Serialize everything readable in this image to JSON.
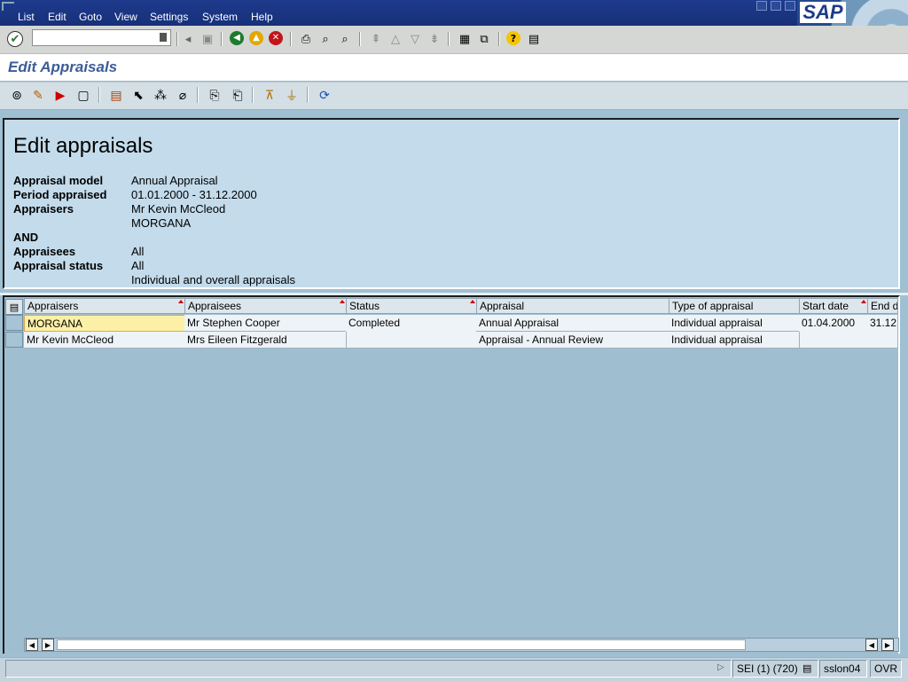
{
  "menu": [
    "List",
    "Edit",
    "Goto",
    "View",
    "Settings",
    "System",
    "Help"
  ],
  "brand": "SAP",
  "title": "Edit Appraisals",
  "header": {
    "heading": "Edit appraisals",
    "fields": [
      {
        "label": "Appraisal model",
        "value": "Annual Appraisal"
      },
      {
        "label": "Period appraised",
        "value": "01.01.2000 - 31.12.2000"
      },
      {
        "label": "Appraisers",
        "value": "Mr Kevin McCleod"
      },
      {
        "label": "",
        "value": "MORGANA"
      },
      {
        "label": "AND",
        "value": ""
      },
      {
        "label": "Appraisees",
        "value": "All"
      },
      {
        "label": "Appraisal status",
        "value": "All"
      },
      {
        "label": "",
        "value": "Individual and overall appraisals"
      }
    ]
  },
  "grid": {
    "columns": [
      "Appraisers",
      "Appraisees",
      "Status",
      "Appraisal",
      "Type of appraisal",
      "Start date",
      "End d"
    ],
    "rows": [
      [
        "MORGANA",
        "Mr Stephen Cooper",
        "Completed",
        "Annual Appraisal",
        "Individual appraisal",
        "01.04.2000",
        "31.12"
      ],
      [
        "Mr Kevin McCleod",
        "Mrs Eileen Fitzgerald",
        "",
        "Appraisal - Annual Review",
        "Individual appraisal",
        "",
        ""
      ]
    ]
  },
  "status": {
    "system": "SEI (1) (720)",
    "server": "sslon04",
    "mode": "OVR"
  },
  "colors": {
    "menubar": "#1e3a8c",
    "title": "#3c5c96",
    "panel": "#c3dbeb",
    "grid_bg": "#9fbfd0",
    "selected_cell": "#fcf0a6"
  }
}
